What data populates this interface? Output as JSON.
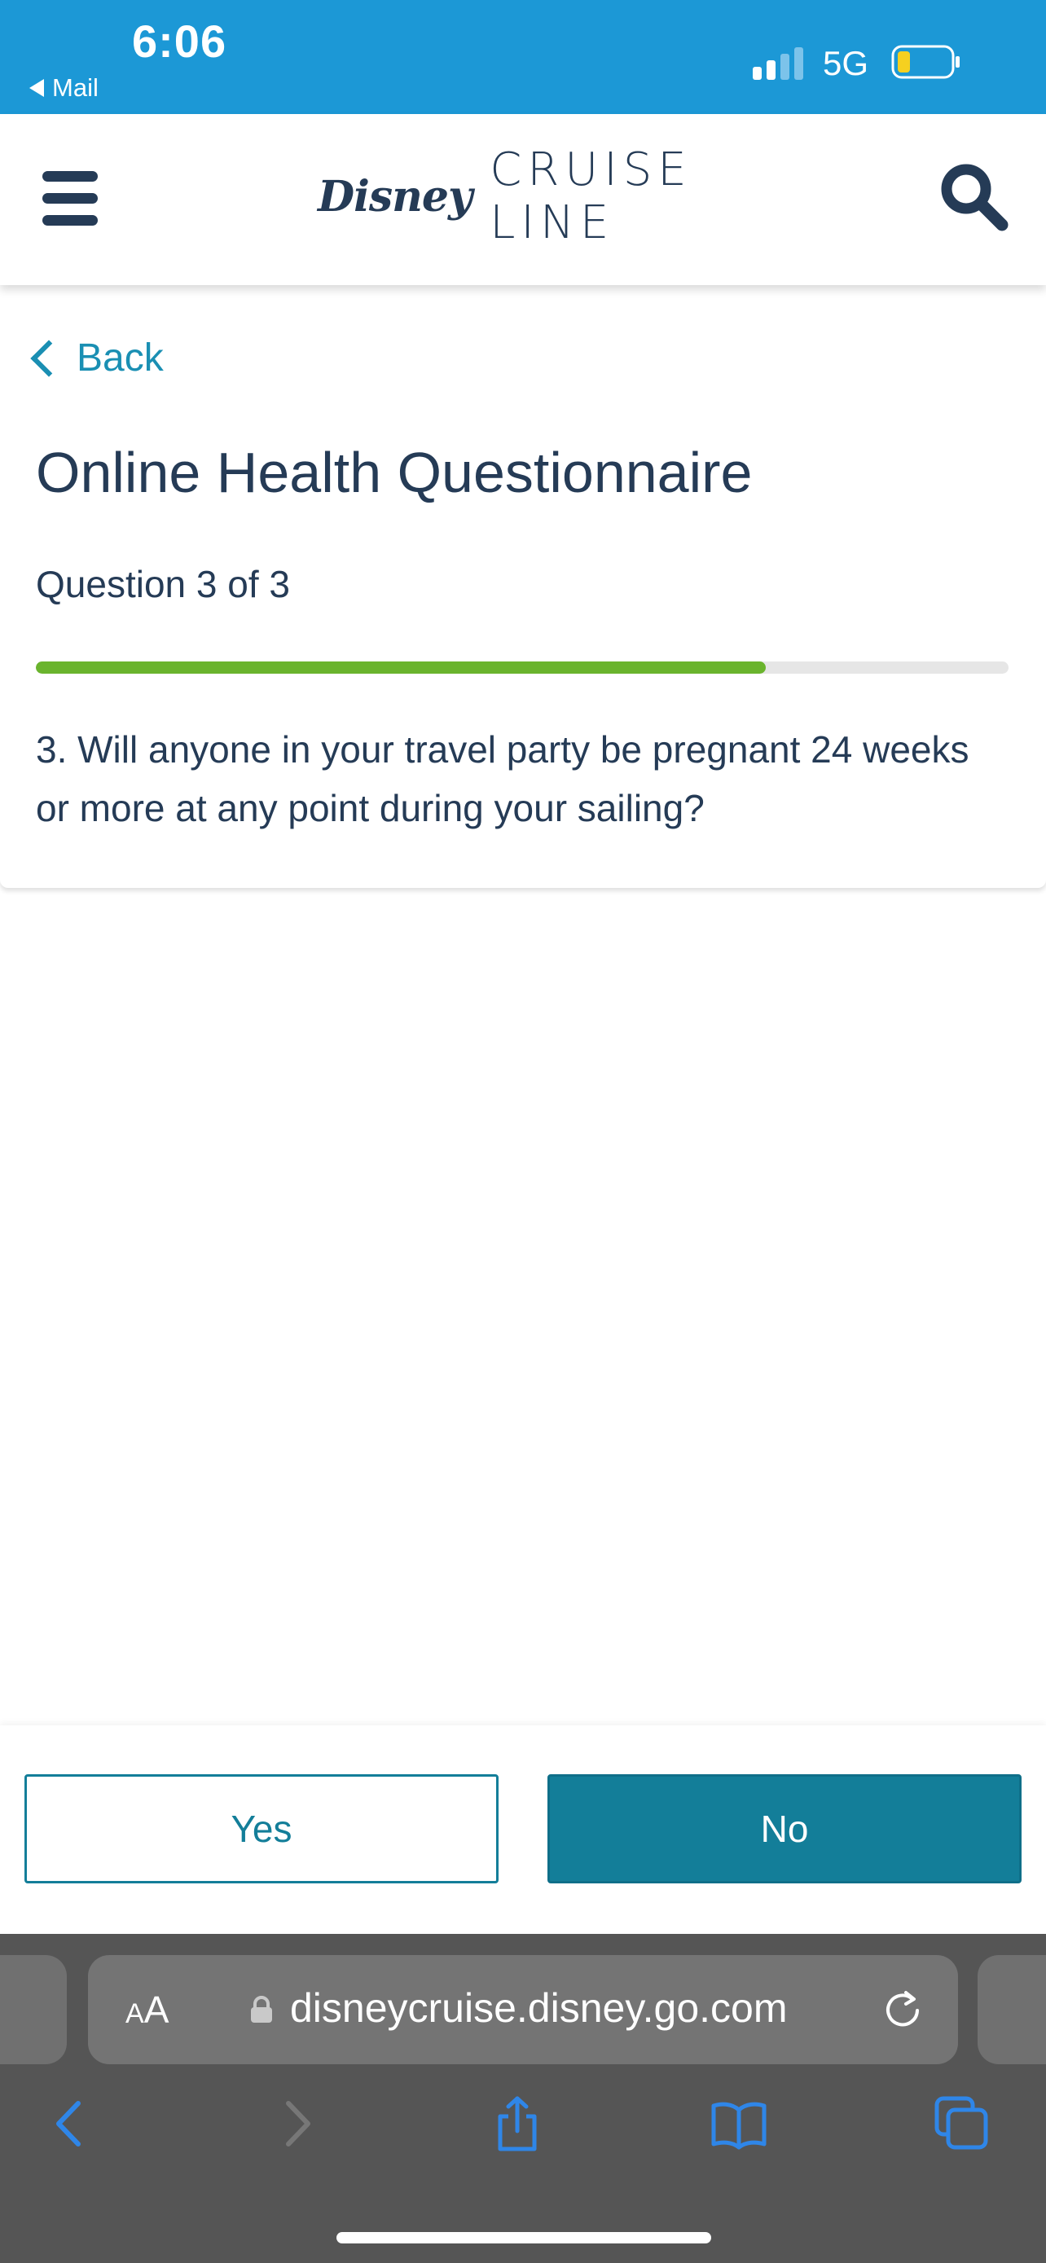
{
  "status_bar": {
    "time": "6:06",
    "back_app": "Mail",
    "network": "5G"
  },
  "header": {
    "logo_disney": "Disney",
    "logo_cruise_line": "CRUISE LINE"
  },
  "content": {
    "back_label": "Back",
    "title": "Online Health Questionnaire",
    "question_count": "Question 3 of 3",
    "progress_fraction": 0.75,
    "question_text": "3. Will anyone in your travel party be pregnant 24 weeks or more at any point during your sailing?"
  },
  "answers": {
    "yes_label": "Yes",
    "no_label": "No"
  },
  "browser": {
    "text_size_big": "A",
    "text_size_small": "A",
    "url": "disneycruise.disney.go.com"
  },
  "colors": {
    "status_bar": "#1c98d6",
    "brand_navy": "#253b56",
    "accent_teal": "#137e99",
    "link_blue": "#1a8fb3",
    "progress_green": "#6ab42d",
    "battery_level": "#f5d020",
    "safari_icons": "#2f86e8"
  },
  "icons": {
    "menu": "hamburger-icon",
    "search": "search-icon",
    "back": "chevron-left-icon",
    "lock": "lock-icon",
    "reload": "reload-icon",
    "nav_back": "chevron-left-icon",
    "nav_forward": "chevron-right-icon",
    "share": "share-icon",
    "bookmarks": "book-icon",
    "tabs": "tabs-icon"
  }
}
